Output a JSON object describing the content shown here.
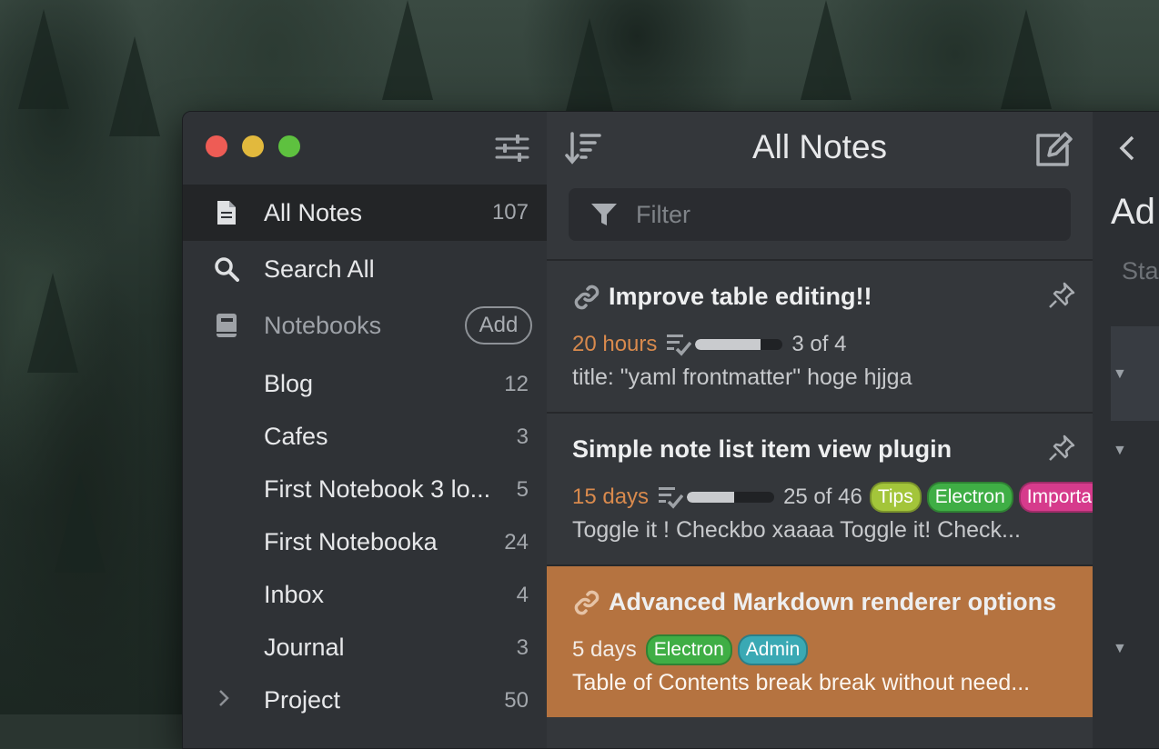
{
  "window": {
    "settings_icon": "sliders-icon"
  },
  "sidebar": {
    "nav": [
      {
        "label": "All Notes",
        "count": "107",
        "icon": "file-icon"
      },
      {
        "label": "Search All",
        "icon": "search-icon"
      },
      {
        "label": "Notebooks",
        "icon": "book-icon",
        "add_label": "Add"
      }
    ],
    "notebooks": [
      {
        "label": "Blog",
        "count": "12"
      },
      {
        "label": "Cafes",
        "count": "3"
      },
      {
        "label": "First Notebook 3 lo...",
        "count": "5"
      },
      {
        "label": "First Notebooka",
        "count": "24"
      },
      {
        "label": "Inbox",
        "count": "4"
      },
      {
        "label": "Journal",
        "count": "3"
      },
      {
        "label": "Project",
        "count": "50",
        "expand_icon": "chevron-right-icon"
      }
    ]
  },
  "notelist": {
    "title": "All Notes",
    "filter_placeholder": "Filter",
    "notes": [
      {
        "title": "Improve table editing!!",
        "date": "20 hours",
        "tasks": "3 of 4",
        "progress": 0.75,
        "tags": [],
        "snippet": "title: \"yaml frontmatter\" hoge hjjga",
        "pinned": true,
        "linked": true
      },
      {
        "title": "Simple note list item view plugin",
        "date": "15 days",
        "tasks": "25 of 46",
        "progress": 0.54,
        "tags": [
          {
            "label": "Tips",
            "color": "#a3c53a"
          },
          {
            "label": "Electron",
            "color": "#3fae45"
          },
          {
            "label": "Importar",
            "color": "#d63b8c"
          }
        ],
        "snippet": "Toggle it ! Checkbo xaaaa Toggle it! Check...",
        "pinned": true,
        "linked": false
      },
      {
        "title": "Advanced Markdown renderer options",
        "date": "5 days",
        "tags": [
          {
            "label": "Electron",
            "color": "#3fae45"
          },
          {
            "label": "Admin",
            "color": "#3aa9b4"
          }
        ],
        "snippet": "Table of Contents break break without need...",
        "selected": true,
        "linked": true
      }
    ]
  },
  "editor": {
    "title": "Ad",
    "subtitle": "Sta"
  }
}
